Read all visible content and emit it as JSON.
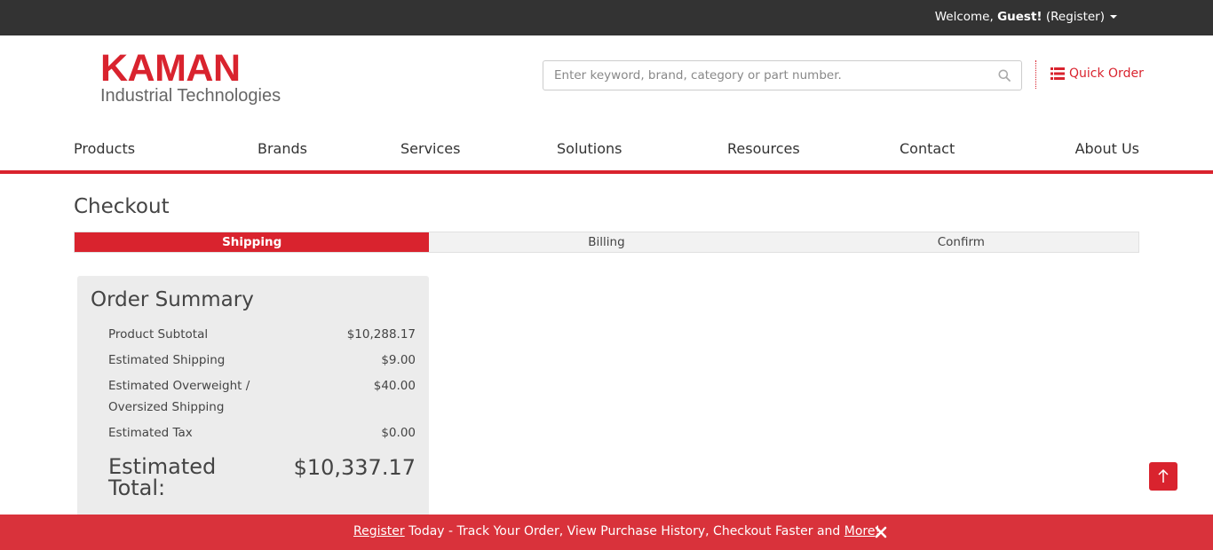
{
  "topbar": {
    "welcome_prefix": "Welcome, ",
    "guest_name": "Guest!",
    "register_link": " (Register)"
  },
  "logo": {
    "brand": "KAMAN",
    "tagline": "Industrial Technologies"
  },
  "search": {
    "placeholder": "Enter keyword, brand, category or part number.",
    "value": ""
  },
  "quick_order": {
    "label": "Quick Order"
  },
  "nav": {
    "items": [
      {
        "label": "Products"
      },
      {
        "label": "Brands"
      },
      {
        "label": "Services"
      },
      {
        "label": "Solutions"
      },
      {
        "label": "Resources"
      },
      {
        "label": "Contact"
      },
      {
        "label": "About Us"
      }
    ]
  },
  "checkout": {
    "title": "Checkout",
    "steps": [
      {
        "label": "Shipping",
        "active": true
      },
      {
        "label": "Billing",
        "active": false
      },
      {
        "label": "Confirm",
        "active": false
      }
    ]
  },
  "order_summary": {
    "heading": "Order Summary",
    "rows": [
      {
        "label": "Product Subtotal",
        "value": "$10,288.17"
      },
      {
        "label": "Estimated Shipping",
        "value": "$9.00"
      },
      {
        "label": "Estimated Overweight / Oversized Shipping",
        "value": "$40.00"
      },
      {
        "label": "Estimated Tax",
        "value": "$0.00"
      }
    ],
    "total_label": "Estimated Total:",
    "total_value": "$10,337.17"
  },
  "banner": {
    "register_link": "Register",
    "text_middle": " Today - Track Your Order, View Purchase History, Checkout Faster and ",
    "more_link": "More",
    "text_end": "!"
  },
  "colors": {
    "brand_red": "#d9232e",
    "topbar": "#333333",
    "summary_bg": "#ececec"
  },
  "icons": {
    "search": "search-icon",
    "quick_order": "list-icon",
    "account_menu": "caret-down-icon",
    "back_to_top": "arrow-up-icon",
    "banner_close": "close-icon"
  }
}
